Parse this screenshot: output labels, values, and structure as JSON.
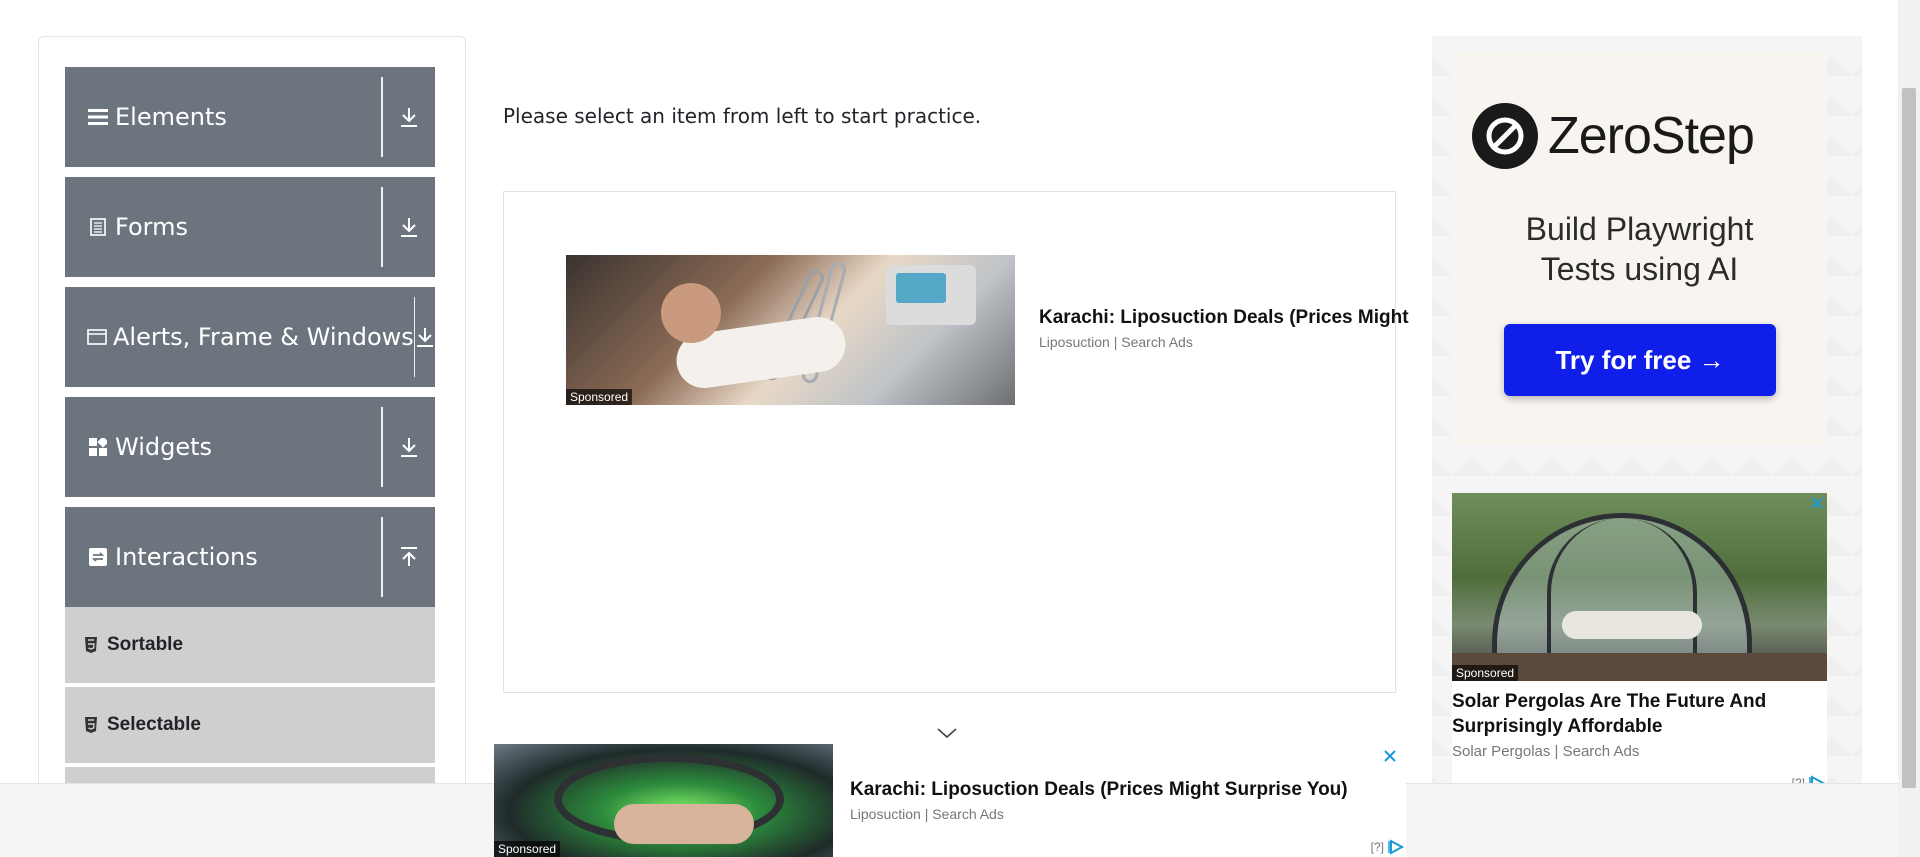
{
  "sidebar": {
    "groups": [
      {
        "label": "Elements",
        "icon": "menu-icon",
        "toggle": "expand-icon"
      },
      {
        "label": "Forms",
        "icon": "document-icon",
        "toggle": "expand-icon"
      },
      {
        "label": "Alerts, Frame & Windows",
        "icon": "window-icon",
        "toggle": "expand-icon"
      },
      {
        "label": "Widgets",
        "icon": "widgets-icon",
        "toggle": "expand-icon"
      },
      {
        "label": "Interactions",
        "icon": "interactions-icon",
        "toggle": "collapse-icon"
      }
    ],
    "sub_items": [
      {
        "label": "Sortable",
        "icon": "html5-icon"
      },
      {
        "label": "Selectable",
        "icon": "html5-icon"
      }
    ]
  },
  "main": {
    "instruction": "Please select an item from left to start practice."
  },
  "ads": {
    "native": {
      "sponsored": "Sponsored",
      "title": "Karachi: Liposuction Deals (Prices Might",
      "source": "Liposuction | Search Ads"
    },
    "zerostep": {
      "brand": "ZeroStep",
      "tagline_line1": "Build Playwright",
      "tagline_line2": "Tests using AI",
      "cta": "Try for free →",
      "cta_color": "#0f1ee8"
    },
    "pergola": {
      "sponsored": "Sponsored",
      "title": "Solar Pergolas Are The Future And Surprisingly Affordable",
      "source": "Solar Pergolas | Search Ads",
      "adchoices": "[?]"
    },
    "bottom": {
      "sponsored": "Sponsored",
      "title": "Karachi: Liposuction Deals (Prices Might Surprise You)",
      "source": "Liposuction | Search Ads",
      "adchoices": "[?]"
    }
  },
  "colors": {
    "sidebar_header": "#6c757d",
    "sidebar_sub": "#cfcfcf",
    "adchoices_blue": "#1a9bd7"
  }
}
